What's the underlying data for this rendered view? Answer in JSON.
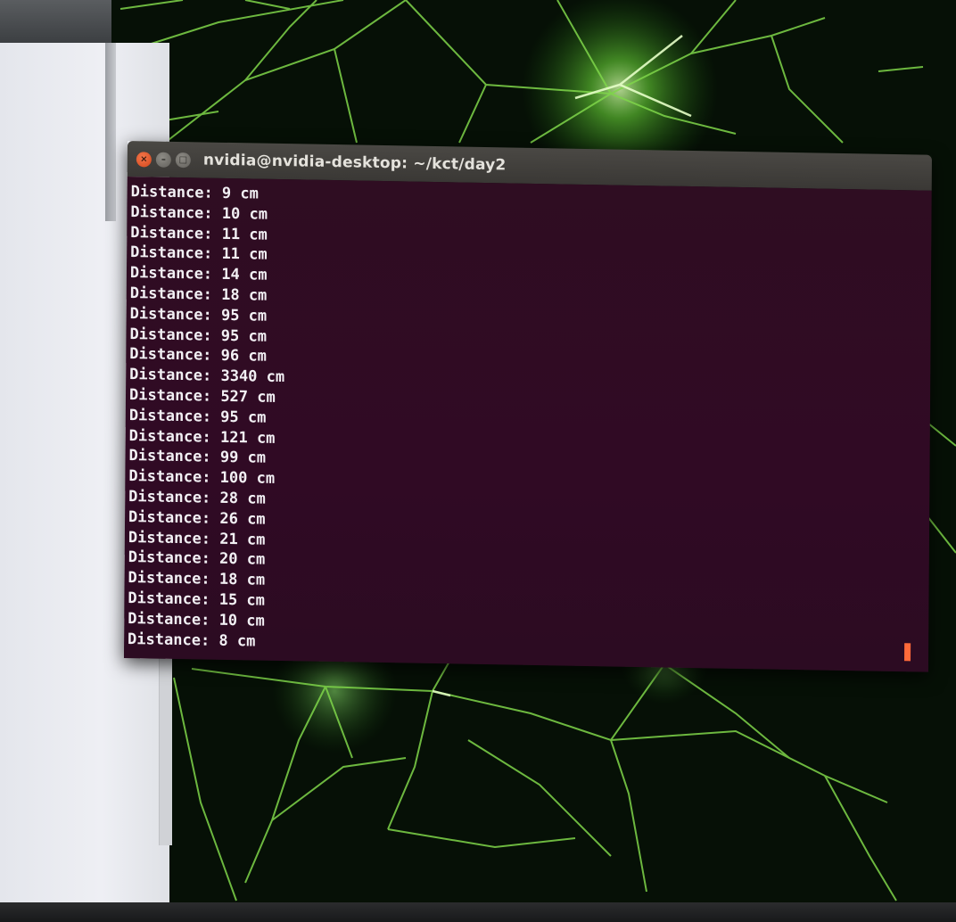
{
  "window": {
    "title": "nvidia@nvidia-desktop: ~/kct/day2",
    "close_icon": "×",
    "minimize_icon": "–",
    "maximize_icon": "□"
  },
  "terminal": {
    "lines": [
      "Distance: 9 cm",
      "Distance: 10 cm",
      "Distance: 11 cm",
      "Distance: 11 cm",
      "Distance: 14 cm",
      "Distance: 18 cm",
      "Distance: 95 cm",
      "Distance: 95 cm",
      "Distance: 96 cm",
      "Distance: 3340 cm",
      "Distance: 527 cm",
      "Distance: 95 cm",
      "Distance: 121 cm",
      "Distance: 99 cm",
      "Distance: 100 cm",
      "Distance: 28 cm",
      "Distance: 26 cm",
      "Distance: 21 cm",
      "Distance: 20 cm",
      "Distance: 18 cm",
      "Distance: 15 cm",
      "Distance: 10 cm",
      "Distance: 8 cm"
    ]
  },
  "colors": {
    "terminal_bg": "#300a24",
    "titlebar_bg": "#3c3b37",
    "close_button": "#e95420",
    "cursor": "#ff6a3a",
    "text": "#f2f0f4",
    "wallpaper_accent": "#76b900"
  }
}
